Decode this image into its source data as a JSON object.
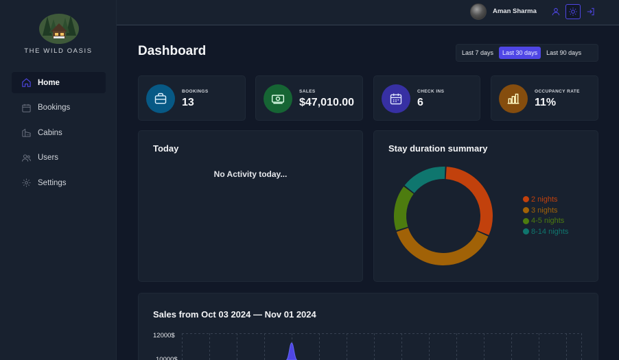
{
  "sidebar": {
    "brand": "THE WILD OASIS",
    "items": [
      {
        "label": "Home",
        "icon": "home-icon",
        "active": true
      },
      {
        "label": "Bookings",
        "icon": "calendar-icon"
      },
      {
        "label": "Cabins",
        "icon": "cabin-icon"
      },
      {
        "label": "Users",
        "icon": "users-icon"
      },
      {
        "label": "Settings",
        "icon": "gear-icon"
      }
    ]
  },
  "header": {
    "username": "Aman Sharma",
    "icons": [
      "account-icon",
      "sun-icon",
      "logout-icon"
    ]
  },
  "page": {
    "title": "Dashboard",
    "filters": [
      "Last 7 days",
      "Last 30 days",
      "Last 90 days"
    ],
    "active_filter": "Last 30 days"
  },
  "stats": [
    {
      "label": "BOOKINGS",
      "value": "13",
      "color": "#075985",
      "icon": "briefcase-icon"
    },
    {
      "label": "SALES",
      "value": "$47,010.00",
      "color": "#166534",
      "icon": "banknotes-icon"
    },
    {
      "label": "CHECK INS",
      "value": "6",
      "color": "#3730a3",
      "icon": "calendar-days-icon"
    },
    {
      "label": "OCCUPANCY RATE",
      "value": "11%",
      "color": "#854d0e",
      "icon": "chart-bar-icon"
    }
  ],
  "today": {
    "title": "Today",
    "empty_text": "No Activity today..."
  },
  "duration": {
    "title": "Stay duration summary"
  },
  "sales": {
    "title": "Sales from Oct 03 2024 — Nov 01 2024",
    "ymax_label": "12000$"
  },
  "chart_data": [
    {
      "type": "pie",
      "title": "Stay duration summary",
      "categories": [
        "2 nights",
        "3 nights",
        "4-5 nights",
        "8-14 nights"
      ],
      "values": [
        4,
        5,
        2,
        2
      ],
      "colors": [
        "#c2410c",
        "#a16207",
        "#4d7c0f",
        "#0f766e"
      ],
      "legend": "right"
    },
    {
      "type": "area",
      "title": "Sales from Oct 03 2024 — Nov 01 2024",
      "y_tick_labels": [
        "12000$"
      ],
      "grid": true
    }
  ],
  "colors": {
    "accent": "#4f46e5",
    "background": "#111827",
    "panel": "#18212f"
  }
}
